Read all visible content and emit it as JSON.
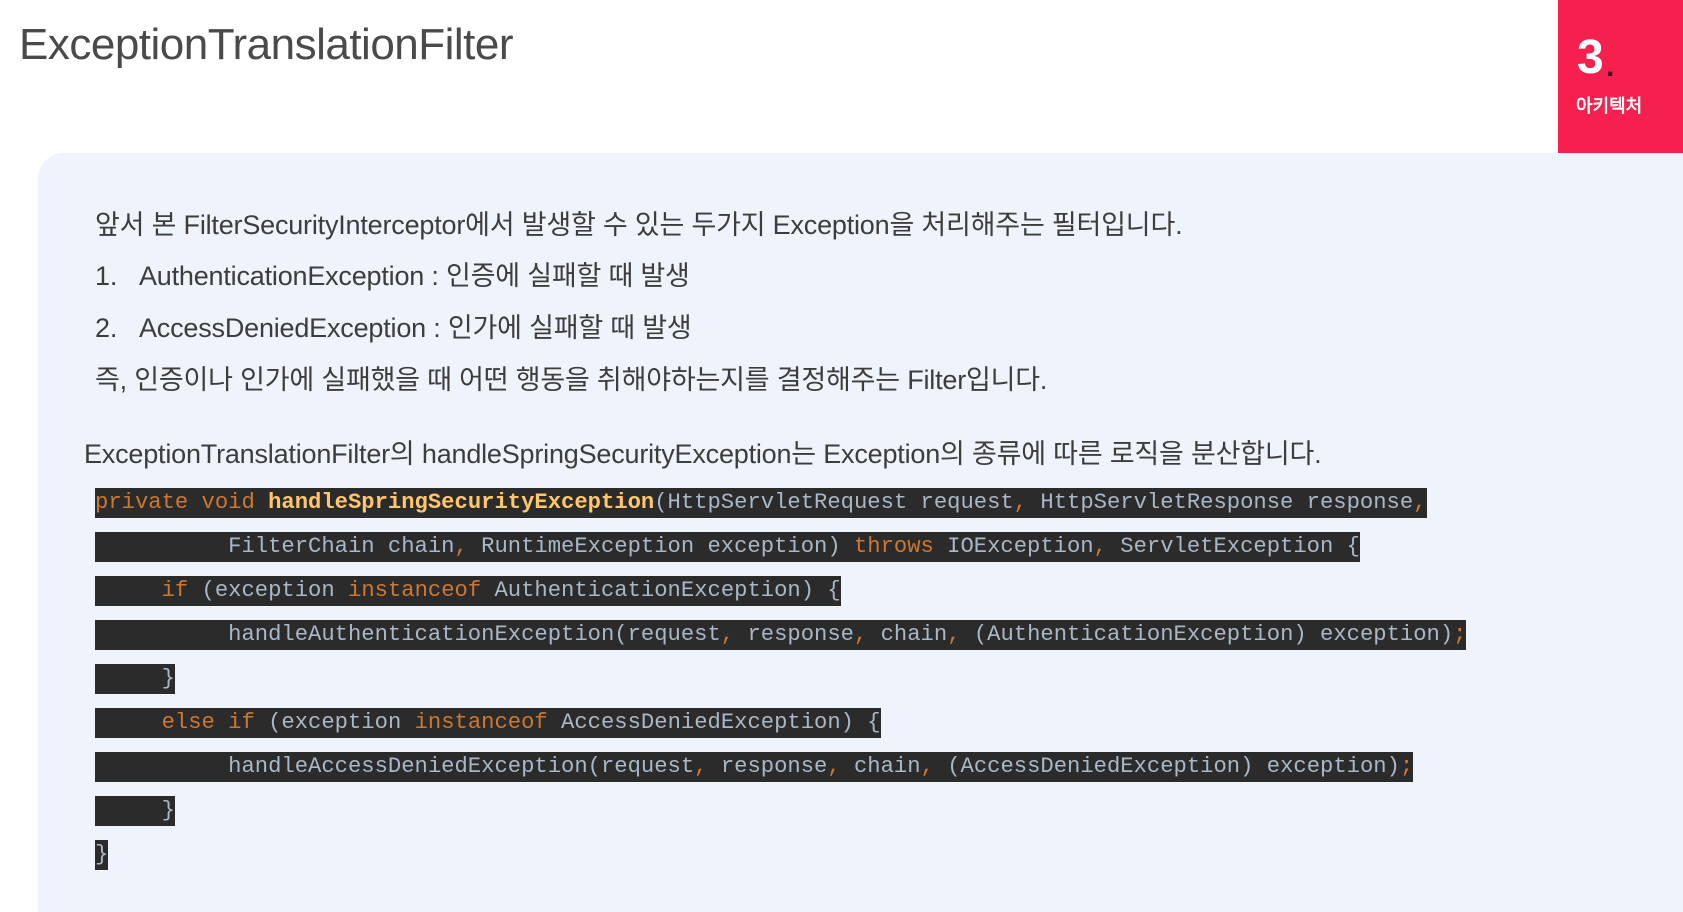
{
  "slide": {
    "title": "ExceptionTranslationFilter",
    "section_number": "3",
    "section_dot": ".",
    "section_label": "아키텍처"
  },
  "content": {
    "intro": "앞서 본 FilterSecurityInterceptor에서 발생할 수 있는 두가지 Exception을 처리해주는 필터입니다.",
    "items": [
      {
        "number": "1.",
        "text": "AuthenticationException : 인증에 실패할 때 발생"
      },
      {
        "number": "2.",
        "text": "AccessDeniedException : 인가에 실패할 때 발생"
      }
    ],
    "summary": "즉, 인증이나 인가에 실패했을 때 어떤 행동을 취해야하는지를 결정해주는 Filter입니다.",
    "code_intro": "ExceptionTranslationFilter의 handleSpringSecurityException는 Exception의 종류에 따른 로직을 분산합니다."
  },
  "code": {
    "lines": [
      [
        [
          "k",
          "private void "
        ],
        [
          "m",
          "handleSpringSecurityException"
        ],
        [
          "t",
          "(HttpServletRequest request"
        ],
        [
          "p",
          ", "
        ],
        [
          "t",
          "HttpServletResponse response"
        ],
        [
          "p",
          ","
        ]
      ],
      [
        [
          "t",
          "          FilterChain chain"
        ],
        [
          "p",
          ", "
        ],
        [
          "t",
          "RuntimeException exception) "
        ],
        [
          "k",
          "throws "
        ],
        [
          "t",
          "IOException"
        ],
        [
          "p",
          ", "
        ],
        [
          "t",
          "ServletException {"
        ]
      ],
      [
        [
          "t",
          "     "
        ],
        [
          "k",
          "if "
        ],
        [
          "t",
          "(exception "
        ],
        [
          "k",
          "instanceof "
        ],
        [
          "t",
          "AuthenticationException) {"
        ]
      ],
      [
        [
          "t",
          "          handleAuthenticationException(request"
        ],
        [
          "p",
          ", "
        ],
        [
          "t",
          "response"
        ],
        [
          "p",
          ", "
        ],
        [
          "t",
          "chain"
        ],
        [
          "p",
          ", "
        ],
        [
          "t",
          "(AuthenticationException) exception)"
        ],
        [
          "p",
          ";"
        ]
      ],
      [
        [
          "t",
          "     }"
        ]
      ],
      [
        [
          "t",
          "     "
        ],
        [
          "k",
          "else if "
        ],
        [
          "t",
          "(exception "
        ],
        [
          "k",
          "instanceof "
        ],
        [
          "t",
          "AccessDeniedException) {"
        ]
      ],
      [
        [
          "t",
          "          handleAccessDeniedException(request"
        ],
        [
          "p",
          ", "
        ],
        [
          "t",
          "response"
        ],
        [
          "p",
          ", "
        ],
        [
          "t",
          "chain"
        ],
        [
          "p",
          ", "
        ],
        [
          "t",
          "(AccessDeniedException) exception)"
        ],
        [
          "p",
          ";"
        ]
      ],
      [
        [
          "t",
          "     }"
        ]
      ],
      [
        [
          "t",
          "}"
        ]
      ]
    ]
  }
}
